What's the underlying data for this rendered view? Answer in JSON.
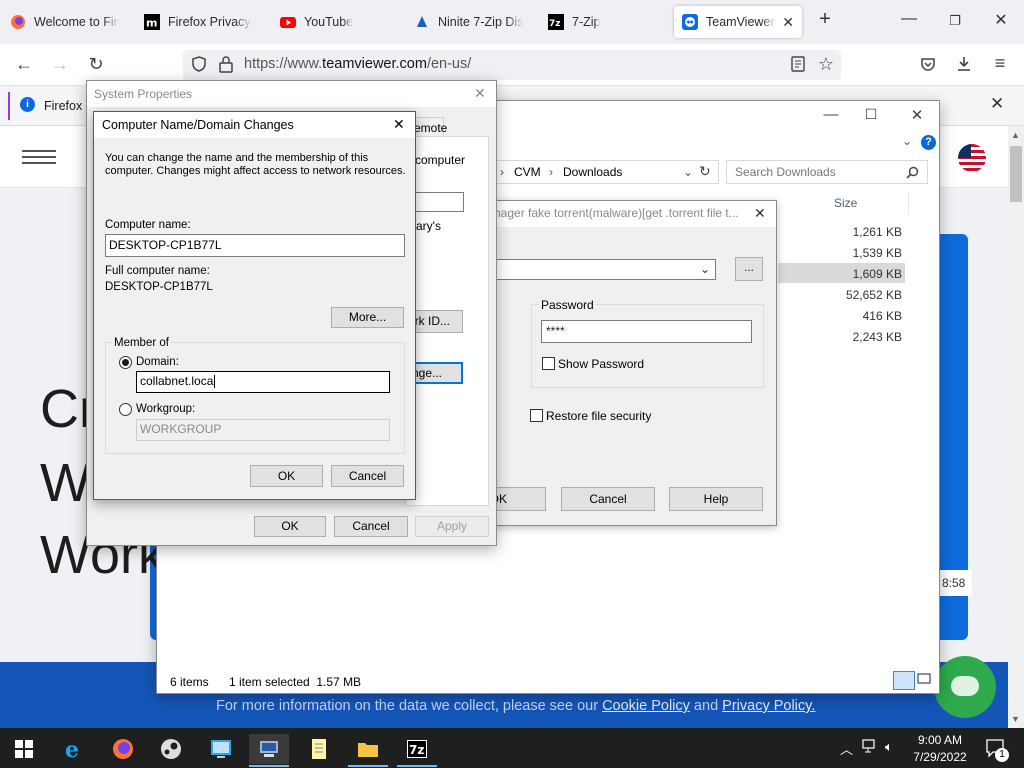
{
  "browser": {
    "tabs": [
      {
        "label": "Welcome to Firefox"
      },
      {
        "label": "Firefox Privacy Notice"
      },
      {
        "label": "YouTube"
      },
      {
        "label": "Ninite 7-Zip Discord"
      },
      {
        "label": "7-Zip"
      },
      {
        "label": "TeamViewer: The"
      }
    ],
    "url_prefix": "https://www.",
    "url_domain": "teamviewer.com",
    "url_path": "/en-us/",
    "notification_text": "Firefox a",
    "colors": {
      "accent": "#0b68e0",
      "notif_bar": "#9a3bd9"
    }
  },
  "website": {
    "big_lines": [
      "Cr",
      "W",
      "Work"
    ],
    "cookie_prefix": "For more information on the data we collect, please see our ",
    "cookie_policy": "Cookie Policy",
    "cookie_and": " and ",
    "privacy_policy": "Privacy Policy.",
    "timestamp_fragment": "8:58"
  },
  "explorer": {
    "breadcrumb_1": "CVM",
    "breadcrumb_2": "Downloads",
    "search_placeholder": "Search Downloads",
    "col_date": "Date modified",
    "col_type": "T",
    "col_size": "Size",
    "sizes": [
      "1,261 KB",
      "1,539 KB",
      "1,609 KB",
      "52,652 KB",
      "416 KB",
      "2,243 KB"
    ],
    "status_items": "6 items",
    "status_selected": "1 item selected  1.57 MB"
  },
  "torrent_dialog": {
    "title": "nager fake torrent(malware)[get .torrent file t...",
    "browse_label": "...",
    "password_group": "Password",
    "password_value": "****",
    "show_password": "Show Password",
    "restore_security": "Restore file security",
    "ok": "OK",
    "cancel": "Cancel",
    "help": "Help"
  },
  "system_properties": {
    "title": "System Properties",
    "tab_remote": "emote",
    "text_computer": "computer",
    "text_library": "ary's",
    "network_id_btn": "rk ID...",
    "change_btn": "nge...",
    "ok": "OK",
    "cancel": "Cancel",
    "apply": "Apply"
  },
  "computer_name_dialog": {
    "title": "Computer Name/Domain Changes",
    "intro_line1": "You can change the name and the membership of this",
    "intro_line2": "computer. Changes might affect access to network resources.",
    "computer_name_label": "Computer name:",
    "computer_name_value": "DESKTOP-CP1B77L",
    "full_name_label": "Full computer name:",
    "full_name_value": "DESKTOP-CP1B77L",
    "more_btn": "More...",
    "member_of": "Member of",
    "domain_label": "Domain:",
    "domain_value": "collabnet.loca",
    "workgroup_label": "Workgroup:",
    "workgroup_value": "WORKGROUP",
    "ok": "OK",
    "cancel": "Cancel"
  },
  "taskbar": {
    "time": "9:00 AM",
    "date": "7/29/2022",
    "notifications": "1",
    "icons": [
      "windows-start",
      "internet-explorer",
      "firefox",
      "steam",
      "remote-desktop",
      "system-computer",
      "notepad",
      "file-explorer",
      "7zip"
    ]
  }
}
